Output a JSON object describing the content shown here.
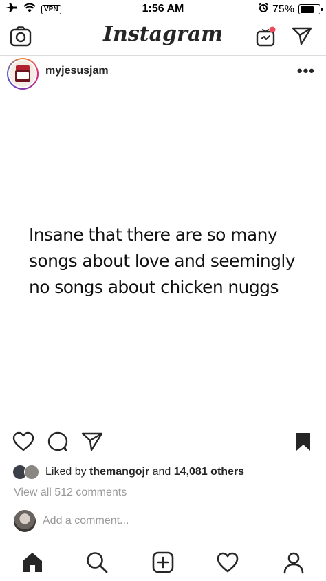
{
  "status_bar": {
    "vpn_label": "VPN",
    "time": "1:56 AM",
    "battery_text": "75%",
    "battery_level": 0.75,
    "icons": [
      "airplane-icon",
      "wifi-icon",
      "alarm-icon",
      "battery-icon"
    ]
  },
  "top_nav": {
    "logo": "Instagram",
    "icons": [
      "camera-icon",
      "igtv-icon",
      "direct-message-icon"
    ],
    "notification_dot_color": "#ed4956"
  },
  "post": {
    "username": "myjesusjam",
    "more": "•••",
    "text_lines": [
      "Insane that there are so many",
      "songs about love and seemingly",
      "no songs about chicken nuggs"
    ],
    "likes": {
      "prefix": "Liked by",
      "user": "themangojr",
      "connector": "and",
      "count": "14,081 others"
    },
    "view_comments": "View all 512 comments",
    "add_comment_placeholder": "Add a comment..."
  },
  "actions": {
    "icons": [
      "heart-icon",
      "comment-icon",
      "share-icon",
      "bookmark-icon"
    ]
  },
  "tab_bar": {
    "icons": [
      "home-icon",
      "search-icon",
      "new-post-icon",
      "activity-heart-icon",
      "profile-icon"
    ]
  }
}
